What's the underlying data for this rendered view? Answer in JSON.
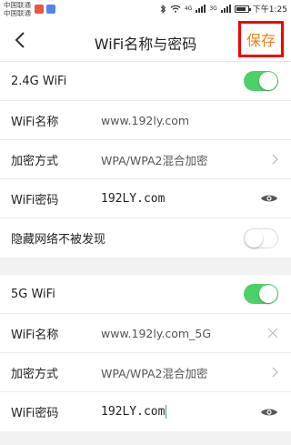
{
  "status_bar": {
    "carrier_1": "中国联通",
    "carrier_2": "中国联通",
    "signal_1": "4G",
    "signal_2": "3G",
    "time": "下午1:25"
  },
  "header": {
    "title": "WiFi名称与密码",
    "save_label": "保存"
  },
  "band_24g": {
    "toggle_label": "2.4G WiFi",
    "toggle_on": true,
    "name_label": "WiFi名称",
    "name_value": "www.192ly.com",
    "encryption_label": "加密方式",
    "encryption_value": "WPA/WPA2混合加密",
    "password_label": "WiFi密码",
    "password_value": "192LY.com",
    "hidden_label": "隐藏网络不被发现",
    "hidden_on": false
  },
  "band_5g": {
    "toggle_label": "5G WiFi",
    "toggle_on": true,
    "name_label": "WiFi名称",
    "name_value": "www.192ly.com_5G",
    "encryption_label": "加密方式",
    "encryption_value": "WPA/WPA2混合加密",
    "password_label": "WiFi密码",
    "password_value": "192LY.com"
  },
  "colors": {
    "accent_green": "#4cd167",
    "save_text": "#f07d1e",
    "highlight_border": "#f20000"
  }
}
